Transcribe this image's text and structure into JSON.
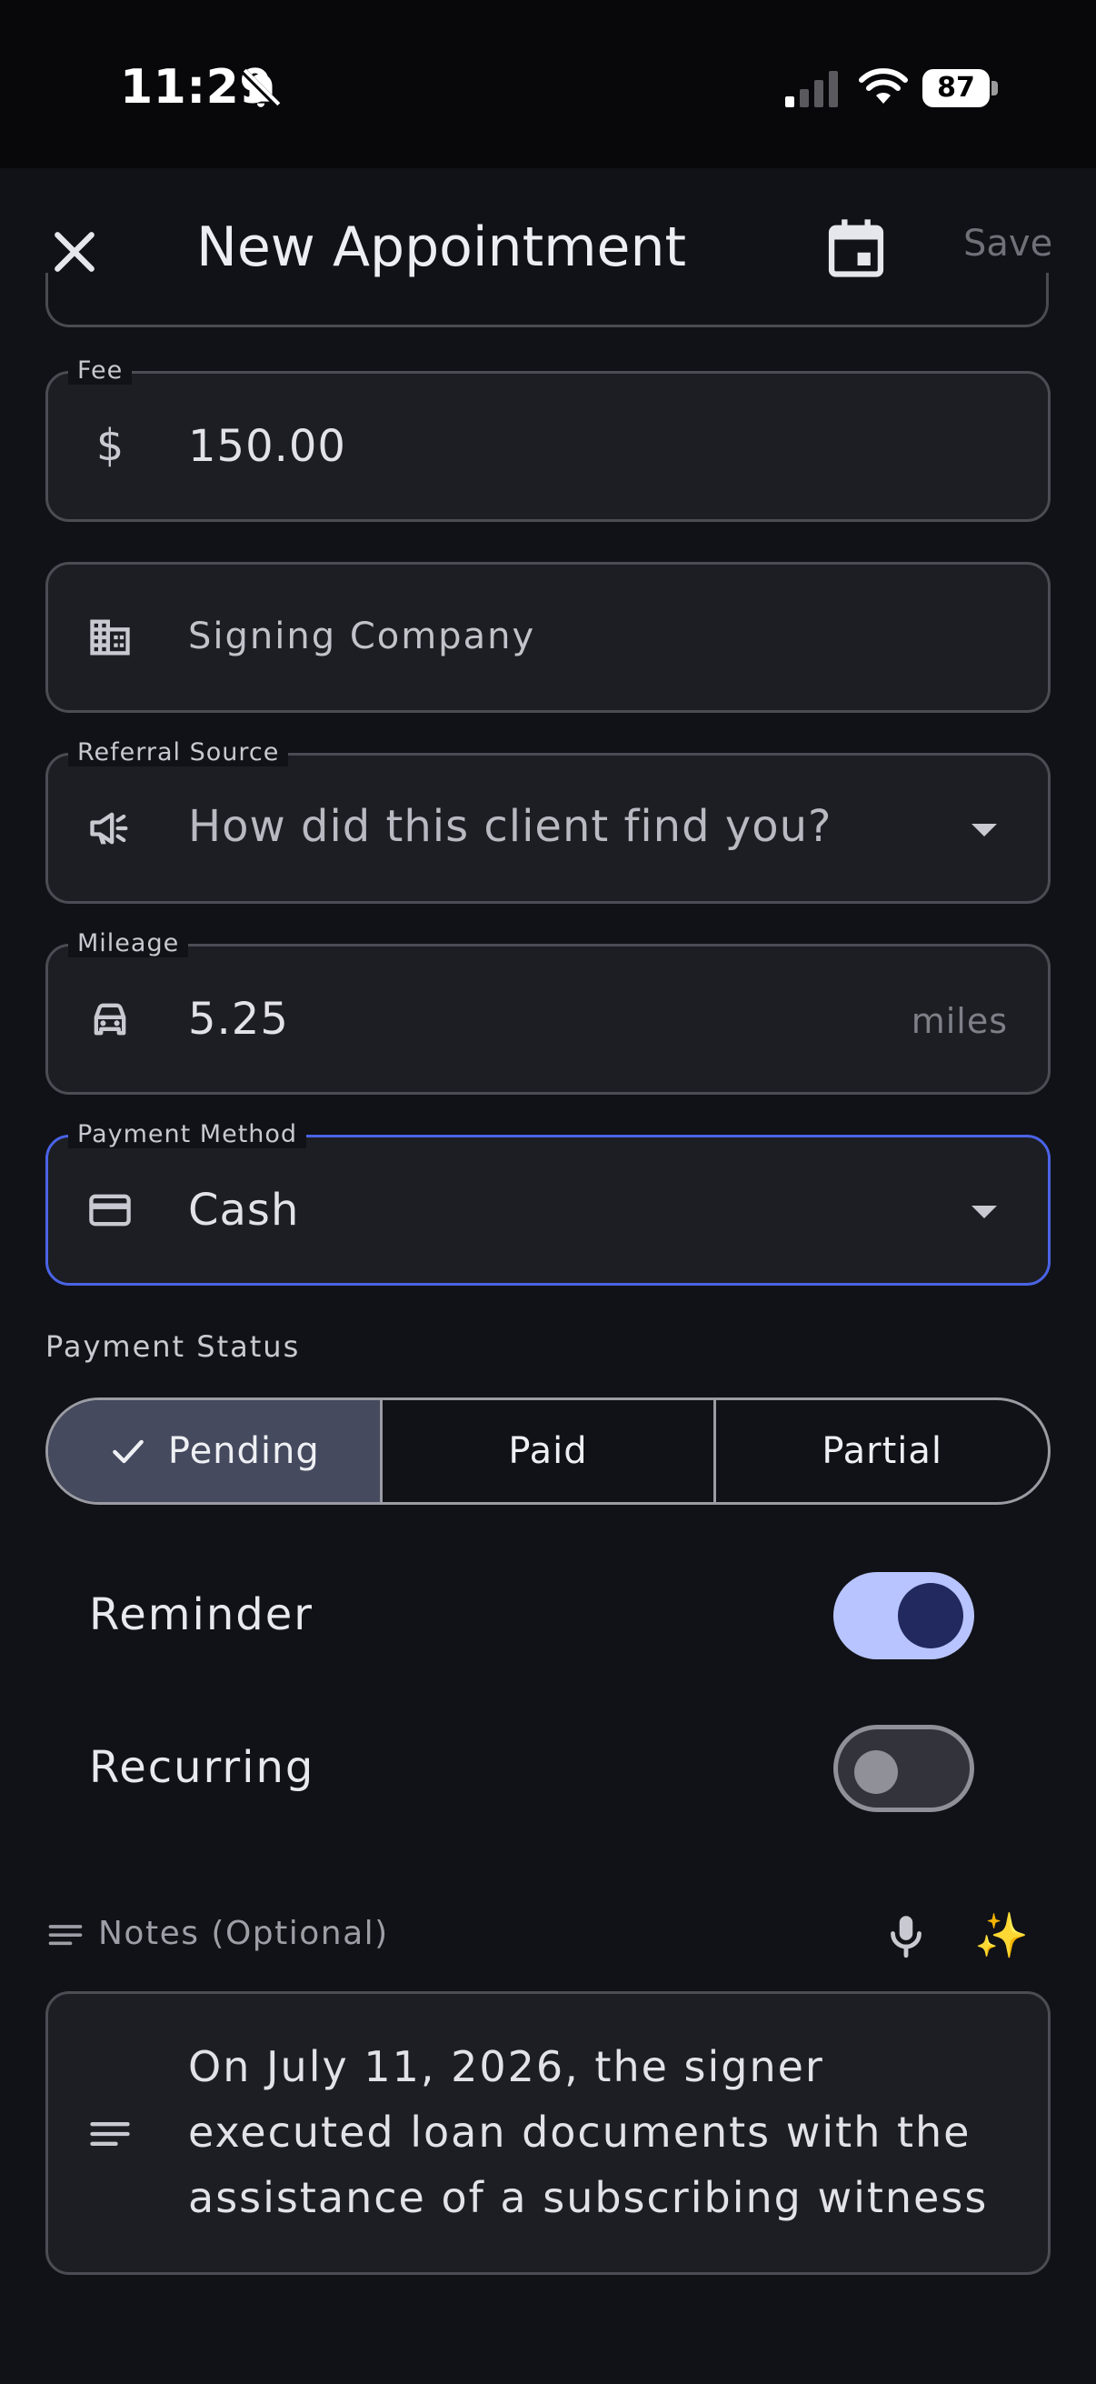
{
  "status_bar": {
    "time": "11:29",
    "battery": "87",
    "icons": [
      "bell-slash-icon",
      "cellular-signal-icon",
      "wifi-icon",
      "battery-icon"
    ]
  },
  "app_bar": {
    "title": "New Appointment",
    "save_label": "Save",
    "icons": [
      "close-icon",
      "calendar-icon"
    ]
  },
  "fields": {
    "fee": {
      "label": "Fee",
      "value": "150.00",
      "icon": "dollar-icon"
    },
    "signing_company": {
      "placeholder": "Signing Company",
      "icon": "building-icon"
    },
    "referral_source": {
      "label": "Referral Source",
      "placeholder": "How did this client find you?",
      "icon": "megaphone-icon"
    },
    "mileage": {
      "label": "Mileage",
      "value": "5.25",
      "suffix": "miles",
      "icon": "car-icon"
    },
    "payment_method": {
      "label": "Payment Method",
      "value": "Cash",
      "icon": "credit-card-icon"
    }
  },
  "payment_status": {
    "label": "Payment Status",
    "options": [
      "Pending",
      "Paid",
      "Partial"
    ],
    "selected": "Pending"
  },
  "toggles": {
    "reminder": {
      "label": "Reminder",
      "on": true
    },
    "recurring": {
      "label": "Recurring",
      "on": false
    }
  },
  "notes": {
    "label": "Notes (Optional)",
    "text": "On July 11, 2026, the signer executed loan documents with the assistance of a subscribing witness",
    "sparkle": "✨"
  },
  "colors": {
    "background": "#111217",
    "field_bg": "#1d1e23",
    "focus_accent": "#4a63e6",
    "toggle_on_track": "#b8c4ff",
    "toggle_on_knob": "#21295f",
    "segment_selected": "#454a5e"
  }
}
